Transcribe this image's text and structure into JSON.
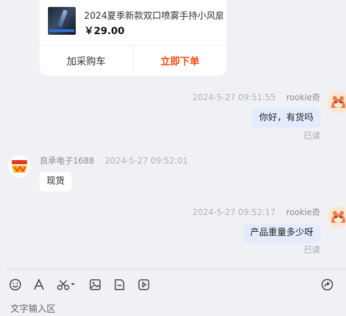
{
  "product_card": {
    "title": "2024夏季新款双口喷雾手持小风扇",
    "price": "￥29.00",
    "add_to_cart_label": "加采购车",
    "buy_now_label": "立即下单"
  },
  "messages": [
    {
      "side": "right",
      "timestamp": "2024-5-27 09:51:55",
      "sender": "rookie奇",
      "text": "你好，有货吗",
      "status": "已读"
    },
    {
      "side": "left",
      "timestamp": "2024-5-27 09:52:01",
      "sender": "良承电子1688",
      "text": "现货"
    },
    {
      "side": "right",
      "timestamp": "2024-5-27 09:52:17",
      "sender": "rookie奇",
      "text": "产品重量多少呀",
      "status": "已读"
    }
  ],
  "toolbar": {
    "icons": [
      "emoji-icon",
      "font-icon",
      "scissors-icon",
      "image-icon",
      "file-icon",
      "video-icon",
      "share-icon"
    ]
  },
  "input": {
    "placeholder": "文字输入区"
  },
  "colors": {
    "buy_accent": "#ff4b0a",
    "own_bubble": "#e3ecfd",
    "background": "#f0f1f5"
  }
}
